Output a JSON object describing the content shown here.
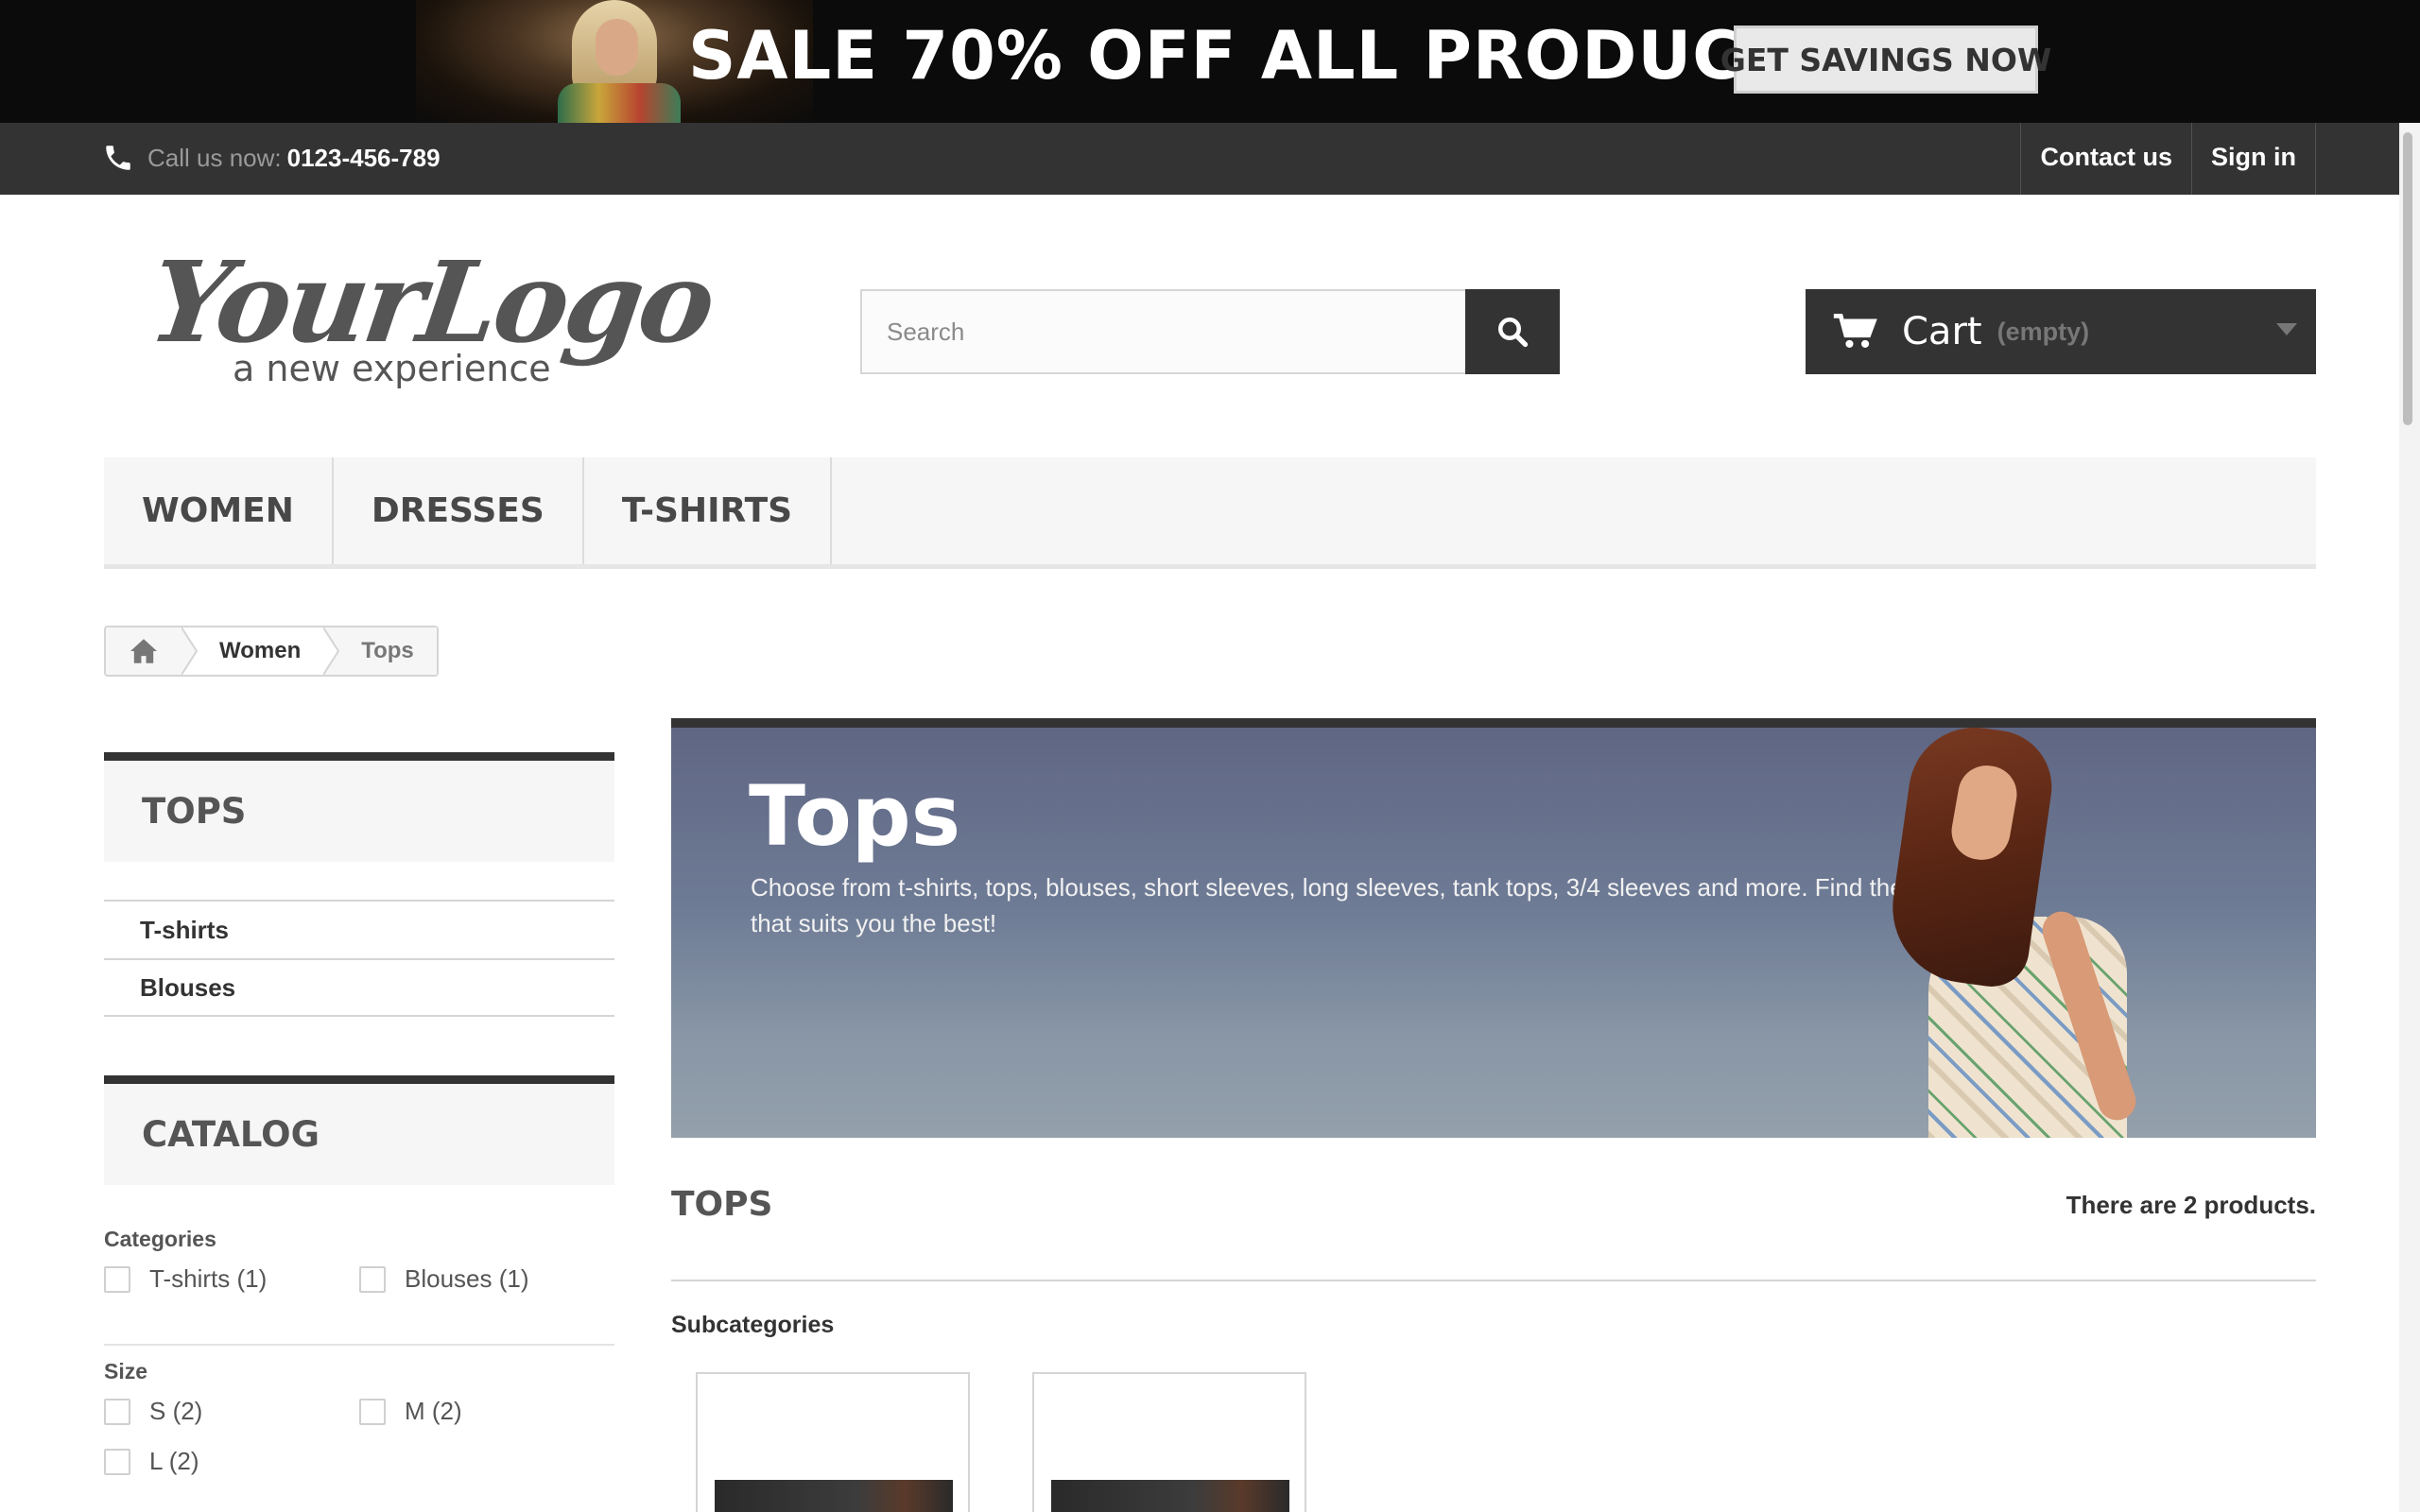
{
  "promo": {
    "headline": "SALE 70% OFF ALL PRODUCTS",
    "cta_label": "GET SAVINGS NOW"
  },
  "topbar": {
    "phone_label": "Call us now:",
    "phone_number": "0123-456-789",
    "links": [
      "Contact us",
      "Sign in"
    ]
  },
  "header": {
    "logo_main": "YourLogo",
    "logo_sub": "a new experience",
    "search_placeholder": "Search",
    "cart_label": "Cart",
    "cart_state": "(empty)"
  },
  "menu": {
    "items": [
      "WOMEN",
      "DRESSES",
      "T-SHIRTS"
    ]
  },
  "breadcrumb": {
    "items": [
      "Women",
      "Tops"
    ]
  },
  "sidebar": {
    "category_title": "TOPS",
    "subcategories": [
      "T-shirts",
      "Blouses"
    ],
    "catalog_title": "CATALOG",
    "facets": {
      "categories": {
        "title": "Categories",
        "options": [
          "T-shirts (1)",
          "Blouses (1)"
        ]
      },
      "size": {
        "title": "Size",
        "options": [
          "S (2)",
          "M (2)",
          "L (2)"
        ]
      }
    }
  },
  "banner": {
    "title": "Tops",
    "description": "Choose from t-shirts, tops, blouses, short sleeves, long sleeves, tank tops, 3/4 sleeves and more. Find the cut that suits you the best!"
  },
  "products": {
    "heading": "TOPS",
    "count_text": "There are 2 products.",
    "subcategories_label": "Subcategories"
  },
  "colors": {
    "dark": "#333333",
    "panel": "#f6f6f6",
    "border": "#d6d4d4"
  }
}
